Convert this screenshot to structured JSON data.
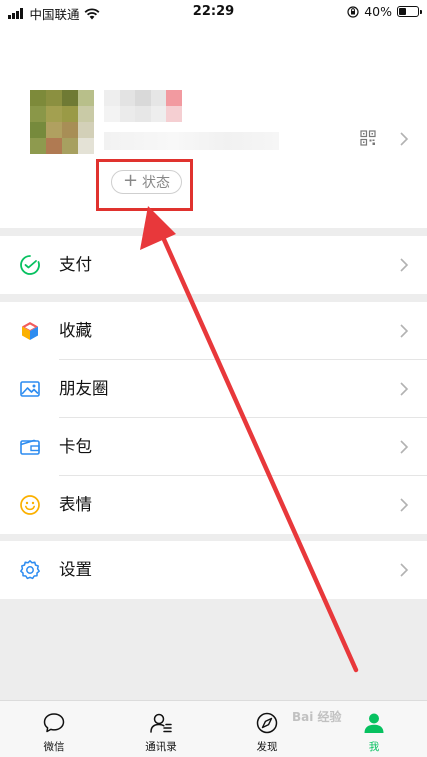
{
  "status_bar": {
    "carrier": "中国联通",
    "time": "22:29",
    "battery": "40%",
    "battery_level": 0.4
  },
  "profile": {
    "status_button_label": "状态"
  },
  "menu": {
    "pay": "支付",
    "favorites": "收藏",
    "moments": "朋友圈",
    "cards": "卡包",
    "stickers": "表情",
    "settings": "设置"
  },
  "tabbar": {
    "chats": "微信",
    "contacts": "通讯录",
    "discover": "发现",
    "me": "我"
  },
  "watermark": "Bai 经验",
  "colors": {
    "accent_green": "#07c160",
    "annotation_red": "#e0322e"
  }
}
